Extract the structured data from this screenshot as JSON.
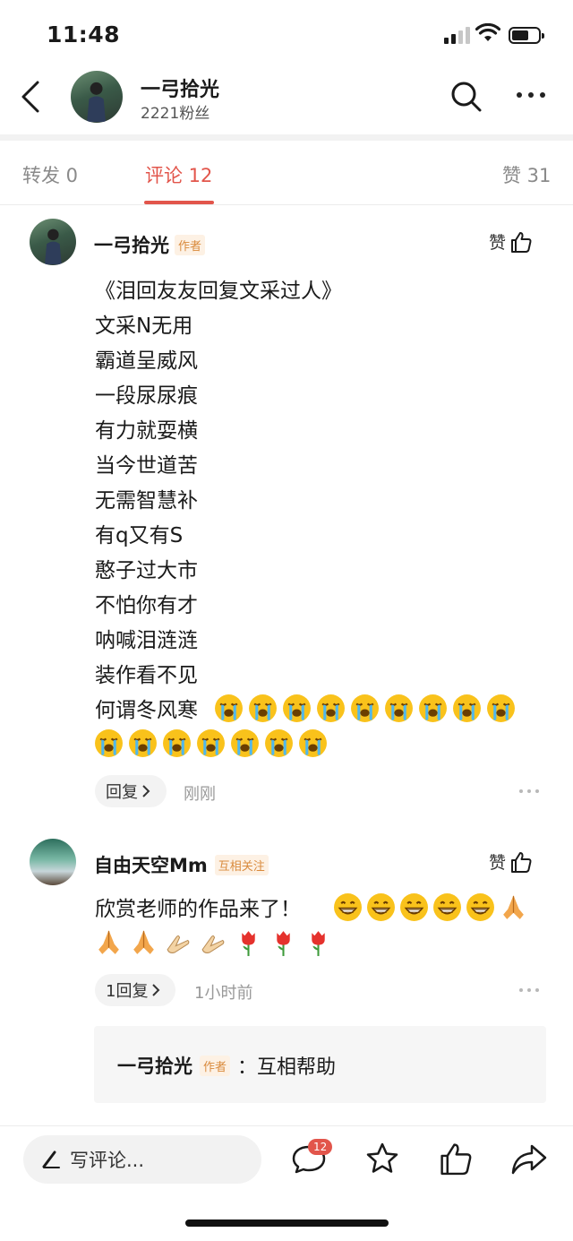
{
  "status_bar": {
    "time": "11:48"
  },
  "header": {
    "name": "一弓拾光",
    "followers": "2221粉丝"
  },
  "tabs": [
    {
      "label": "转发 0"
    },
    {
      "label": "评论 12"
    },
    {
      "label": "赞 31"
    }
  ],
  "comments": [
    {
      "user": "一弓拾光",
      "badge": "作者",
      "like_label": "赞",
      "lines": "《泪回友友回复文采过人》\n文采N无用\n霸道呈威风\n一段尿尿痕\n有力就耍横\n当今世道苦\n无需智慧补\n有q又有S\n憨子过大市\n不怕你有才\n呐喊泪涟涟\n装作看不见\n何谓冬风寒",
      "emoji_row1": [
        "loudly-crying-face",
        "loudly-crying-face",
        "loudly-crying-face",
        "loudly-crying-face",
        "loudly-crying-face",
        "loudly-crying-face",
        "loudly-crying-face",
        "loudly-crying-face",
        "loudly-crying-face"
      ],
      "emoji_row2": [
        "loudly-crying-face",
        "loudly-crying-face",
        "loudly-crying-face",
        "loudly-crying-face",
        "loudly-crying-face",
        "loudly-crying-face",
        "loudly-crying-face"
      ],
      "reply_btn": "回复",
      "time": "刚刚"
    },
    {
      "user": "自由天空Mm",
      "badge": "互相关注",
      "like_label": "赞",
      "text": "欣赏老师的作品来了！",
      "reply_btn": "1回复",
      "time": "1小时前",
      "reply": {
        "user": "一弓拾光",
        "badge": "作者",
        "text": "：互相帮助"
      }
    }
  ],
  "bottom_bar": {
    "compose_placeholder": "写评论...",
    "comment_count": "12"
  },
  "colors": {
    "accent": "#e2554b",
    "badge_text": "#d98a3c",
    "badge_bg": "#fdf1e4"
  }
}
